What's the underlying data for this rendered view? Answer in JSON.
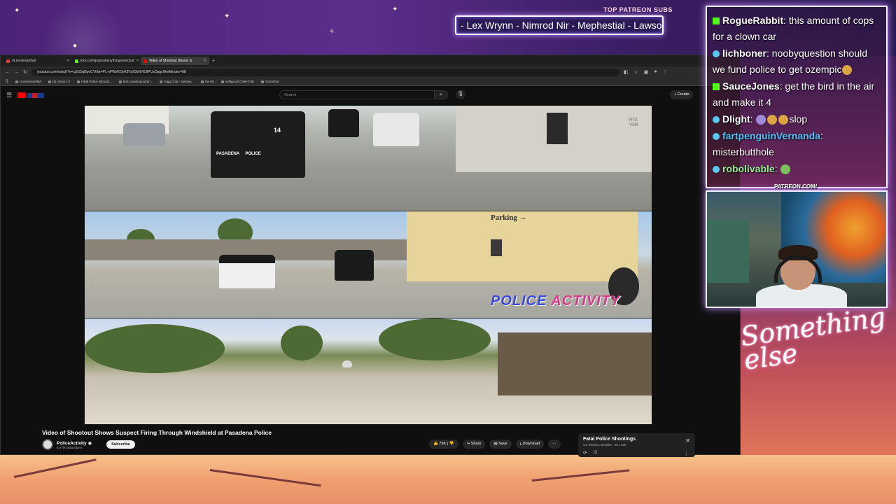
{
  "overlay": {
    "patreon_heading": "TOP PATREON SUBS",
    "patreon_names": "- Lex Wrynn - Nimrod Nir - Mephestial - Lawsor",
    "patreon_url": "PATREON.COM/",
    "signature_text": "Something else"
  },
  "browser": {
    "tabs": [
      {
        "label": "r/Livestreamfail",
        "icon": "reddit-icon"
      },
      {
        "label": "kick.com/popout/anythingelse/chat",
        "icon": "kick-icon"
      },
      {
        "label": "Video of Shootout Shows S",
        "icon": "youtube-icon"
      }
    ],
    "new_tab": "+",
    "url": "youtube.com/watch?v=cj5S3xjBpoCYIlist=PL-oFWdXOyK8TqfObGH6JlPLlxDagcWwMindex=88",
    "bookmarks": [
      "r/Livestreamfail",
      "(3) Home / X",
      "Fatal Police Shootin...",
      "kick.com/popout/an...",
      "Digg Chat - Destiny...",
      "the list",
      "evlfige.gif (299×278)",
      "Omnichat"
    ]
  },
  "youtube": {
    "search_placeholder": "Search",
    "create_label": "Create",
    "video_title": "Video of Shootout Shows Suspect Firing Through Windshield at Pasadena Police",
    "channel_name": "PoliceActivity",
    "channel_subs": "6.87M subscribers",
    "subscribe_label": "Subscribe",
    "like_count": "79K",
    "share_label": "Share",
    "save_label": "Save",
    "download_label": "Download",
    "more_label": "···",
    "watermark_left": "POLICE",
    "watermark_right": "ACTIVITY",
    "parking_sign": "Parking →",
    "video_corner_tag": "RTX VSR",
    "car_number": "14",
    "car_text": "PASADENA     POLICE",
    "playlist_title": "Fatal Police Shootings",
    "playlist_sub": "US Election Meddler · 65 / 196"
  },
  "chat": {
    "messages": [
      {
        "badge": "kick",
        "user": "RogueRabbit",
        "text": "this amount of cops for a clown car",
        "color": "#ffffff"
      },
      {
        "badge": "bubble",
        "user": "lichboner",
        "text": "noobyquestion should we fund police to get ozempic",
        "color": "#ffffff"
      },
      {
        "badge": "kick",
        "user": "SauceJones",
        "text": "get the bird in the air and make it 4",
        "color": "#ffffff"
      },
      {
        "badge": "bubble",
        "user": "Dlight",
        "text": "slop",
        "color": "#ffffff"
      },
      {
        "badge": "bubble",
        "user": "fartpenguinVernanda",
        "text": "misterbutthole",
        "color": "#4fc3f7"
      },
      {
        "badge": "bubble",
        "user": "robolivable",
        "text": "",
        "color": "#90ee90"
      }
    ]
  },
  "colors": {
    "kick_green": "#53fc18",
    "youtube_red": "#ff0000",
    "neon_glow": "#c58cff"
  }
}
